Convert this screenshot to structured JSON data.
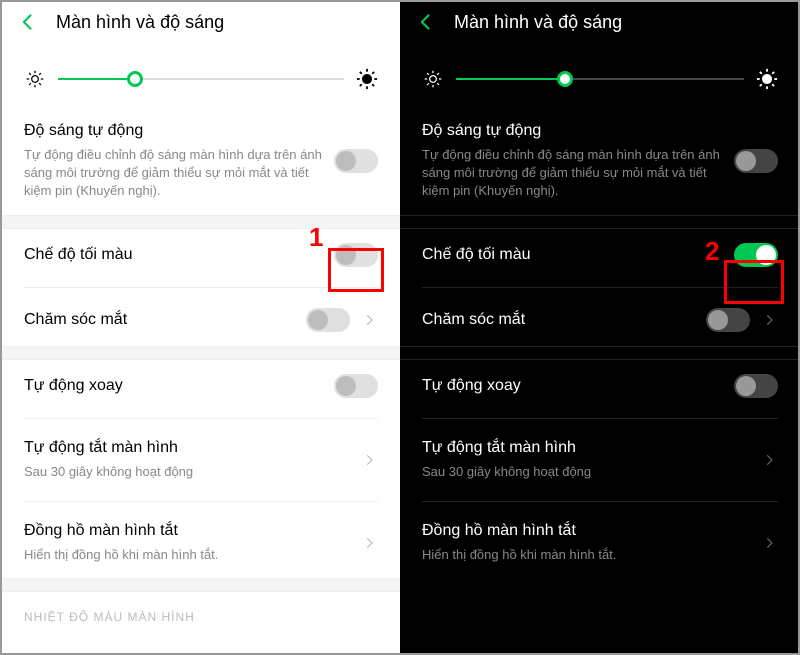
{
  "header": {
    "title": "Màn hình và độ sáng"
  },
  "brightness": {
    "light_pct": 27,
    "dark_pct": 38
  },
  "rows": {
    "auto_brightness": {
      "title": "Độ sáng tự động",
      "desc": "Tự động điều chỉnh độ sáng màn hình dựa trên ánh sáng môi trường để giảm thiểu sự mỏi mắt và tiết kiệm pin (Khuyến nghị)."
    },
    "dark_mode": {
      "title": "Chế độ tối màu"
    },
    "eye_care": {
      "title": "Chăm sóc mắt"
    },
    "auto_rotate": {
      "title": "Tự động xoay"
    },
    "auto_off": {
      "title": "Tự động tắt màn hình",
      "sub": "Sau 30 giây không hoạt động"
    },
    "aod": {
      "title": "Đồng hồ màn hình tắt",
      "sub": "Hiển thị đồng hồ khi màn hình tắt."
    }
  },
  "footer_label": "NHIỆT ĐỘ MÀU MÀN HÌNH",
  "annotations": {
    "step1": "1",
    "step2": "2"
  }
}
